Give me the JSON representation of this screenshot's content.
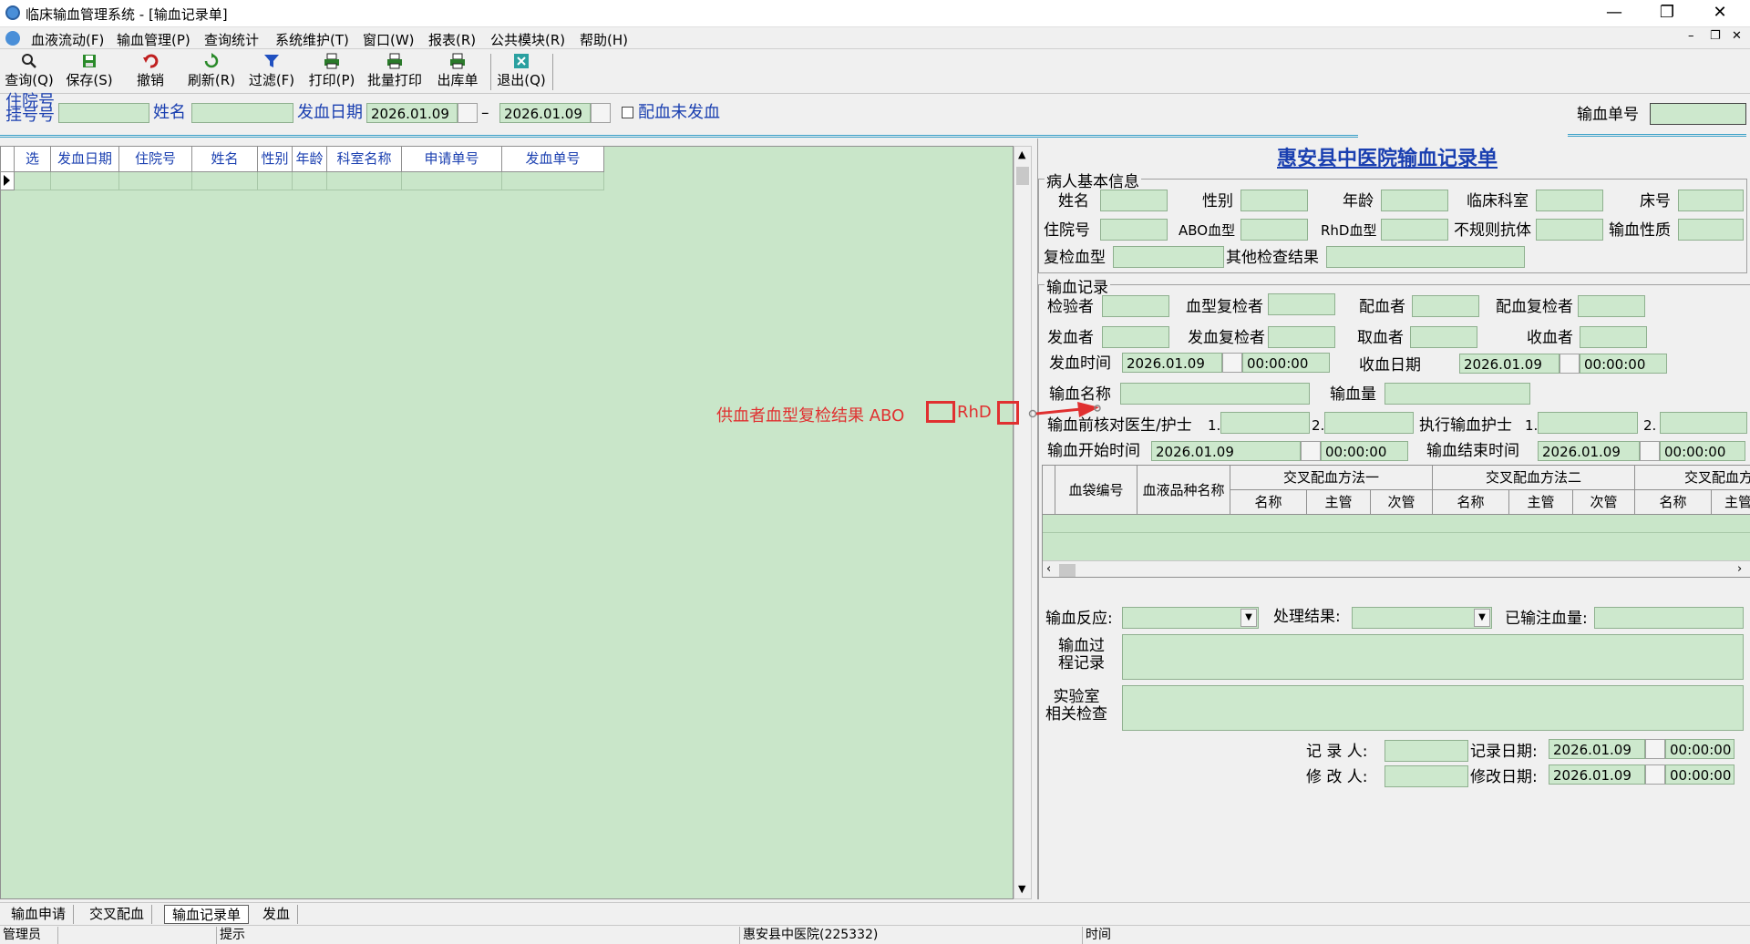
{
  "window": {
    "title": "临床输血管理系统 - [输血记录单]"
  },
  "menu": [
    "血液流动(F)",
    "输血管理(P)",
    "查询统计",
    "系统维护(T)",
    "窗口(W)",
    "报表(R)",
    "公共模块(R)",
    "帮助(H)"
  ],
  "toolbar": {
    "query": "查询(Q)",
    "save": "保存(S)",
    "undo": "撤销",
    "refresh": "刷新(R)",
    "filter": "过滤(F)",
    "print": "打印(P)",
    "batch_print": "批量打印",
    "outbound": "出库单",
    "exit": "退出(Q)"
  },
  "search": {
    "inpatient_label_1": "住院号",
    "inpatient_label_2": "挂号号",
    "name_label": "姓名",
    "date_label": "发血日期",
    "date_from": "2026.01.09",
    "date_to": "2026.01.09",
    "dash": "–",
    "unissued_label": "配血未发血",
    "transfusion_no_label": "输血单号"
  },
  "grid": {
    "columns": [
      "选",
      "发血日期",
      "住院号",
      "姓名",
      "性别",
      "年龄",
      "科室名称",
      "申请单号",
      "发血单号"
    ]
  },
  "record": {
    "title": "惠安县中医院输血记录单",
    "patient_group": "病人基本信息",
    "name": "姓名",
    "sex": "性别",
    "age": "年龄",
    "dept": "临床科室",
    "bed": "床号",
    "inpatient_no": "住院号",
    "abo": "ABO血型",
    "rhd": "RhD血型",
    "irregular": "不规则抗体",
    "trans_type": "输血性质",
    "recheck": "复检血型",
    "other_result": "其他检查结果",
    "trans_group": "输血记录",
    "tester": "检验者",
    "type_rechecker": "血型复检者",
    "matcher": "配血者",
    "match_rechecker": "配血复检者",
    "issuer": "发血者",
    "issue_rechecker": "发血复检者",
    "taker": "取血者",
    "receiver": "收血者",
    "issue_time": "发血时间",
    "issue_date": "2026.01.09",
    "issue_clock": "00:00:00",
    "receive_date_label": "收血日期",
    "receive_date": "2026.01.09",
    "receive_clock": "00:00:00",
    "blood_name": "输血名称",
    "volume": "输血量",
    "donor_check": "供血者血型复检结果 ABO",
    "donor_rhd": "RhD",
    "precheck_doctor": "输血前核对医生/护士",
    "n1": "1.",
    "n2": "2.",
    "exec_nurse": "执行输血护士",
    "start_time": "输血开始时间",
    "start_date": "2026.01.09",
    "start_clock": "00:00:00",
    "end_time": "输血结束时间",
    "end_date": "2026.01.09",
    "end_clock": "00:00:00",
    "table_headers": {
      "bag_no": "血袋编号",
      "product": "血液品种名称",
      "method1": "交叉配血方法一",
      "method2": "交叉配血方法二",
      "method3": "交叉配血方法",
      "sub_name": "名称",
      "sub_main": "主管",
      "sub_minor": "次管"
    },
    "reaction": "输血反应:",
    "result": "处理结果:",
    "infused": "已输注血量:",
    "process_record_1": "输血过",
    "process_record_2": "程记录",
    "lab_check_1": "实验室",
    "lab_check_2": "相关检查",
    "recorder": "记 录 人:",
    "record_date_label": "记录日期:",
    "record_date": "2026.01.09",
    "record_clock": "00:00:00",
    "modifier": "修 改 人:",
    "modify_date_label": "修改日期:",
    "modify_date": "2026.01.09",
    "modify_clock": "00:00:00"
  },
  "tabs": [
    "输血申请",
    "交叉配血",
    "输血记录单",
    "发血"
  ],
  "status": {
    "user": "管理员",
    "hint": "提示",
    "hospital": "惠安县中医院(225332)",
    "time": "时间"
  }
}
